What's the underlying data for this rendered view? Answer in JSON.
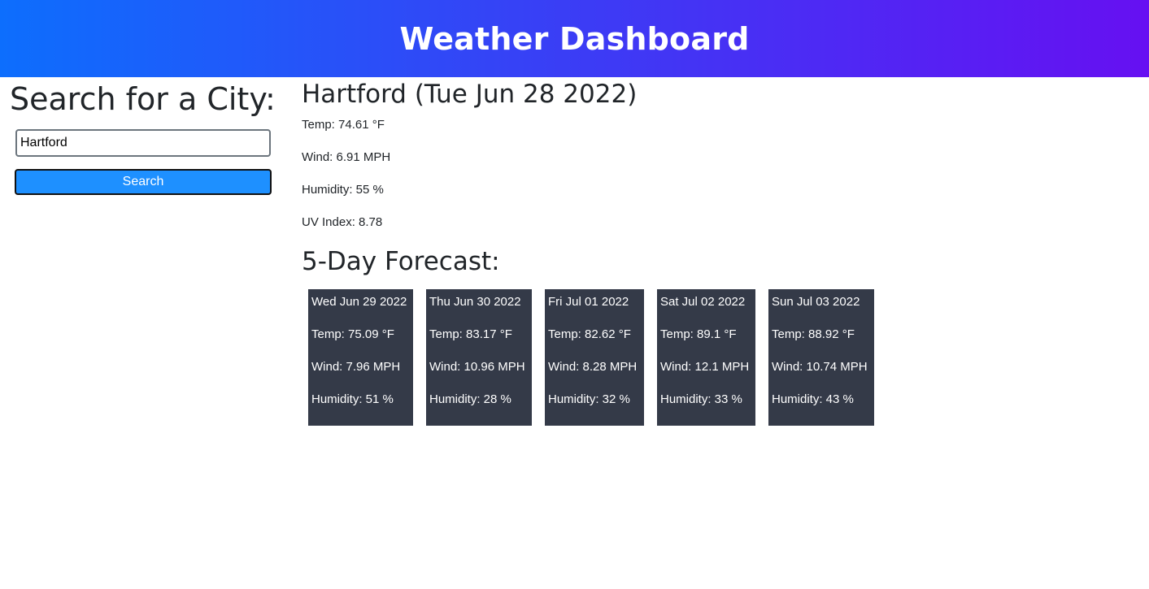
{
  "header": {
    "title": "Weather Dashboard"
  },
  "sidebar": {
    "heading": "Search for a City:",
    "search_value": "Hartford",
    "search_button_label": "Search"
  },
  "current": {
    "heading": "Hartford (Tue Jun 28 2022)",
    "temp": "Temp: 74.61 °F",
    "wind": "Wind: 6.91 MPH",
    "humidity": "Humidity: 55 %",
    "uv": "UV Index: 8.78"
  },
  "forecast": {
    "heading": "5-Day Forecast:",
    "days": [
      {
        "date": "Wed Jun 29 2022",
        "temp": "Temp: 75.09 °F",
        "wind": "Wind: 7.96 MPH",
        "humidity": "Humidity: 51 %"
      },
      {
        "date": "Thu Jun 30 2022",
        "temp": "Temp: 83.17 °F",
        "wind": "Wind: 10.96 MPH",
        "humidity": "Humidity: 28 %"
      },
      {
        "date": "Fri Jul 01 2022",
        "temp": "Temp: 82.62 °F",
        "wind": "Wind: 8.28 MPH",
        "humidity": "Humidity: 32 %"
      },
      {
        "date": "Sat Jul 02 2022",
        "temp": "Temp: 89.1 °F",
        "wind": "Wind: 12.1 MPH",
        "humidity": "Humidity: 33 %"
      },
      {
        "date": "Sun Jul 03 2022",
        "temp": "Temp: 88.92 °F",
        "wind": "Wind: 10.74 MPH",
        "humidity": "Humidity: 43 %"
      }
    ]
  },
  "colors": {
    "header_gradient_start": "#0d6efd",
    "header_gradient_end": "#6610f2",
    "search_button": "#1e90ff",
    "card_background": "#343a48"
  }
}
